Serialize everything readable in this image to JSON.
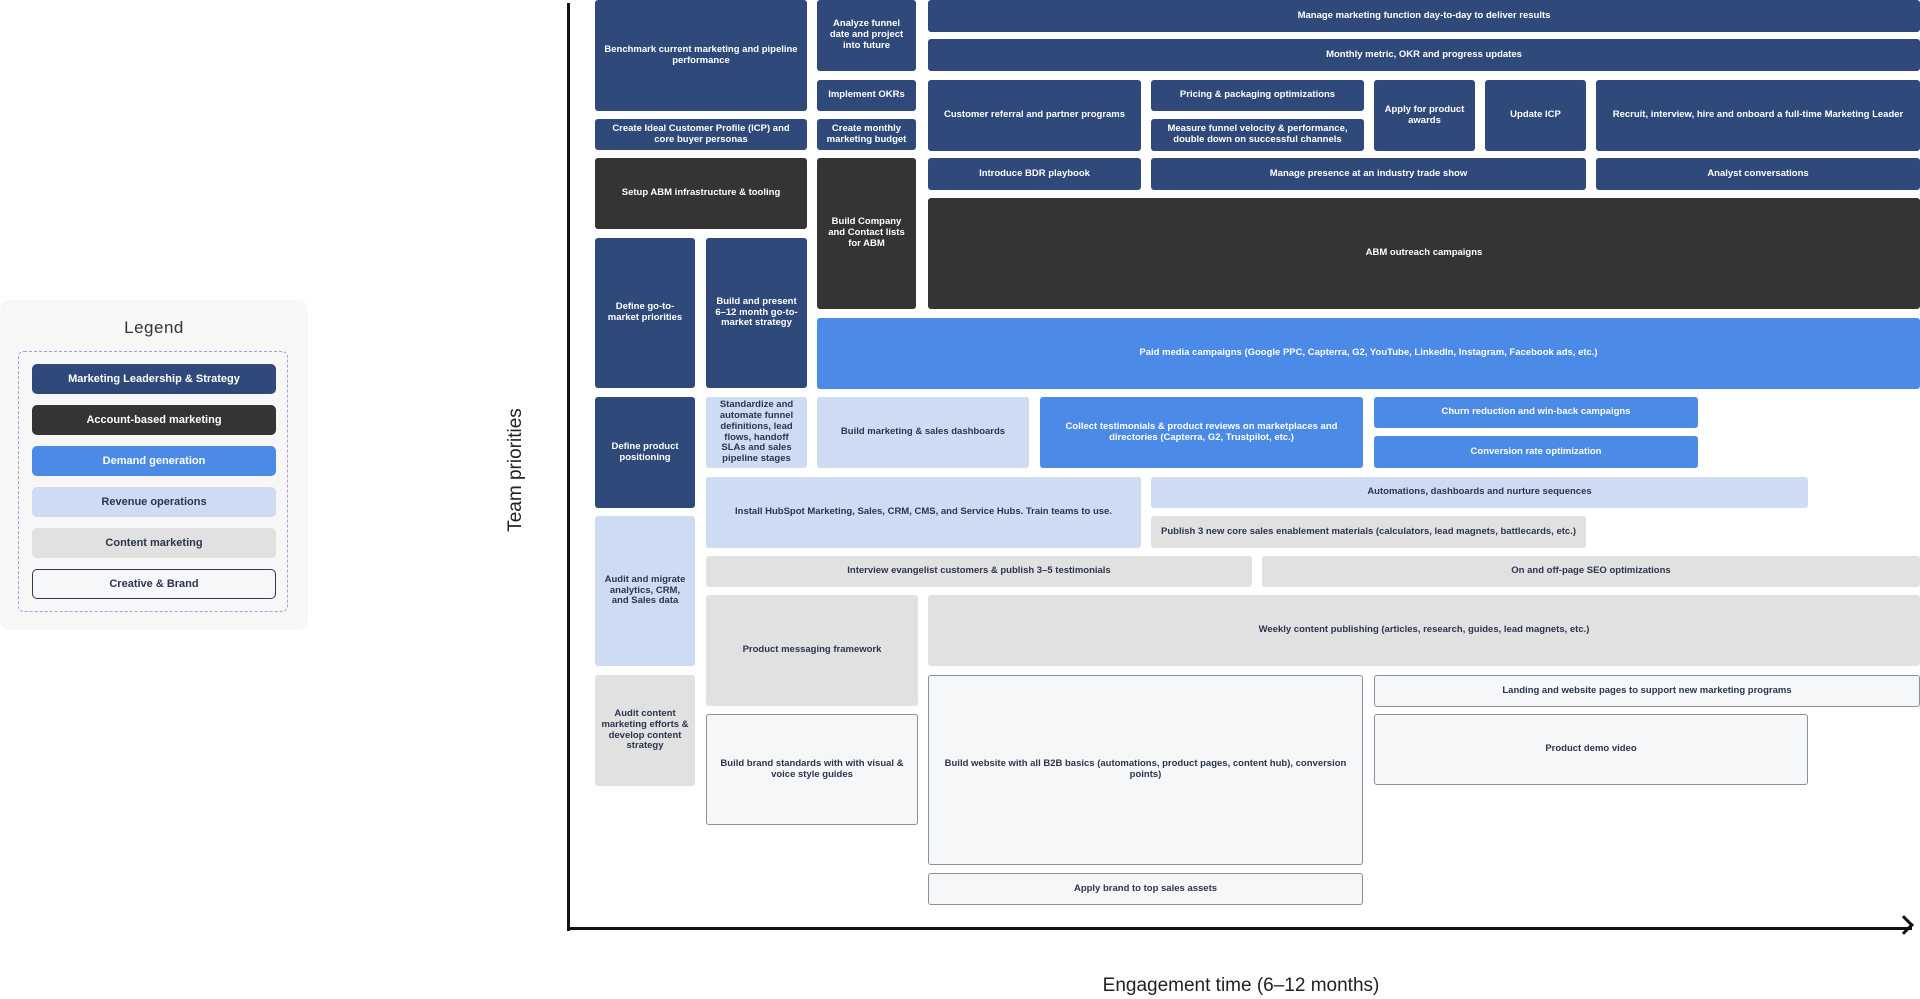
{
  "legend": {
    "title": "Legend",
    "items": [
      {
        "key": "leadership",
        "label": "Marketing Leadership & Strategy",
        "color": "#2f4a7a"
      },
      {
        "key": "abm",
        "label": "Account-based marketing",
        "color": "#343434"
      },
      {
        "key": "demand",
        "label": "Demand generation",
        "color": "#4b8ae6"
      },
      {
        "key": "revops",
        "label": "Revenue operations",
        "color": "#cddcf3"
      },
      {
        "key": "content",
        "label": "Content marketing",
        "color": "#e1e1e1"
      },
      {
        "key": "creative",
        "label": "Creative & Brand",
        "color": "#ffffff"
      }
    ]
  },
  "axes": {
    "y_label": "Team priorities",
    "x_label": "Engagement time (6–12 months)"
  },
  "tasks": [
    {
      "id": "benchmark",
      "label": "Benchmark current marketing and pipeline performance",
      "category": "leadership"
    },
    {
      "id": "analyze-funnel",
      "label": "Analyze funnel date and project into future",
      "category": "leadership"
    },
    {
      "id": "manage-function",
      "label": "Manage marketing function day-to-day to deliver results",
      "category": "leadership"
    },
    {
      "id": "monthly-metric",
      "label": "Monthly metric, OKR and progress updates",
      "category": "leadership"
    },
    {
      "id": "implement-okrs",
      "label": "Implement OKRs",
      "category": "leadership"
    },
    {
      "id": "customer-referral",
      "label": "Customer referral and partner programs",
      "category": "leadership"
    },
    {
      "id": "pricing",
      "label": "Pricing & packaging optimizations",
      "category": "leadership"
    },
    {
      "id": "apply-awards",
      "label": "Apply for product awards",
      "category": "leadership"
    },
    {
      "id": "update-icp",
      "label": "Update ICP",
      "category": "leadership"
    },
    {
      "id": "recruit-leader",
      "label": "Recruit, interview, hire and onboard a full-time Marketing Leader",
      "category": "leadership"
    },
    {
      "id": "create-icp",
      "label": "Create Ideal Customer Profile (ICP) and core buyer personas",
      "category": "leadership"
    },
    {
      "id": "monthly-budget",
      "label": "Create monthly marketing budget",
      "category": "leadership"
    },
    {
      "id": "measure-funnel",
      "label": "Measure funnel velocity & performance, double down on successful channels",
      "category": "leadership"
    },
    {
      "id": "setup-abm",
      "label": "Setup ABM infrastructure & tooling",
      "category": "abm"
    },
    {
      "id": "build-lists",
      "label": "Build Company and Contact lists for ABM",
      "category": "abm"
    },
    {
      "id": "bdr-playbook",
      "label": "Introduce BDR playbook",
      "category": "leadership"
    },
    {
      "id": "trade-show",
      "label": "Manage presence at an industry trade show",
      "category": "leadership"
    },
    {
      "id": "analyst",
      "label": "Analyst conversations",
      "category": "leadership"
    },
    {
      "id": "abm-outreach",
      "label": "ABM outreach campaigns",
      "category": "abm"
    },
    {
      "id": "gtm-priorities",
      "label": "Define go-to-market priorities",
      "category": "leadership"
    },
    {
      "id": "gtm-strategy",
      "label": "Build and present 6–12 month go-to-market strategy",
      "category": "leadership"
    },
    {
      "id": "paid-media",
      "label": "Paid media campaigns (Google PPC, Capterra, G2, YouTube, LinkedIn, Instagram, Facebook ads, etc.)",
      "category": "demand"
    },
    {
      "id": "positioning",
      "label": "Define product positioning",
      "category": "leadership"
    },
    {
      "id": "standardize-funnel",
      "label": "Standardize and automate funnel definitions, lead flows, handoff SLAs and sales pipeline stages",
      "category": "revops"
    },
    {
      "id": "dashboards",
      "label": "Build marketing & sales dashboards",
      "category": "revops"
    },
    {
      "id": "testimonials-reviews",
      "label": "Collect testimonials & product reviews on marketplaces and directories (Capterra, G2, Trustpilot, etc.)",
      "category": "demand"
    },
    {
      "id": "churn",
      "label": "Churn reduction and win-back campaigns",
      "category": "demand"
    },
    {
      "id": "cro",
      "label": "Conversion rate optimization",
      "category": "demand"
    },
    {
      "id": "hubspot",
      "label": "Install HubSpot Marketing, Sales, CRM, CMS, and Service Hubs. Train teams to use.",
      "category": "revops"
    },
    {
      "id": "automations",
      "label": "Automations, dashboards and nurture sequences",
      "category": "revops"
    },
    {
      "id": "enablement",
      "label": "Publish 3 new core sales enablement materials (calculators, lead magnets, battlecards, etc.)",
      "category": "content"
    },
    {
      "id": "audit-migrate",
      "label": "Audit and migrate analytics, CRM, and Sales data",
      "category": "revops"
    },
    {
      "id": "interview-evangelists",
      "label": "Interview evangelist customers & publish 3–5 testimonials",
      "category": "content"
    },
    {
      "id": "seo",
      "label": "On and off-page SEO optimizations",
      "category": "content"
    },
    {
      "id": "messaging",
      "label": "Product messaging framework",
      "category": "content"
    },
    {
      "id": "weekly-content",
      "label": "Weekly content publishing (articles, research, guides, lead magnets, etc.)",
      "category": "content"
    },
    {
      "id": "audit-content",
      "label": "Audit content marketing efforts & develop content strategy",
      "category": "content"
    },
    {
      "id": "brand-standards",
      "label": "Build brand standards with with visual & voice style guides",
      "category": "creative"
    },
    {
      "id": "website",
      "label": "Build website with all B2B basics (automations, product pages, content hub), conversion points)",
      "category": "creative"
    },
    {
      "id": "landing-pages",
      "label": "Landing and website pages to support new marketing programs",
      "category": "creative"
    },
    {
      "id": "demo-video",
      "label": "Product demo video",
      "category": "creative"
    },
    {
      "id": "brand-sales-assets",
      "label": "Apply brand to top sales assets",
      "category": "creative"
    }
  ]
}
